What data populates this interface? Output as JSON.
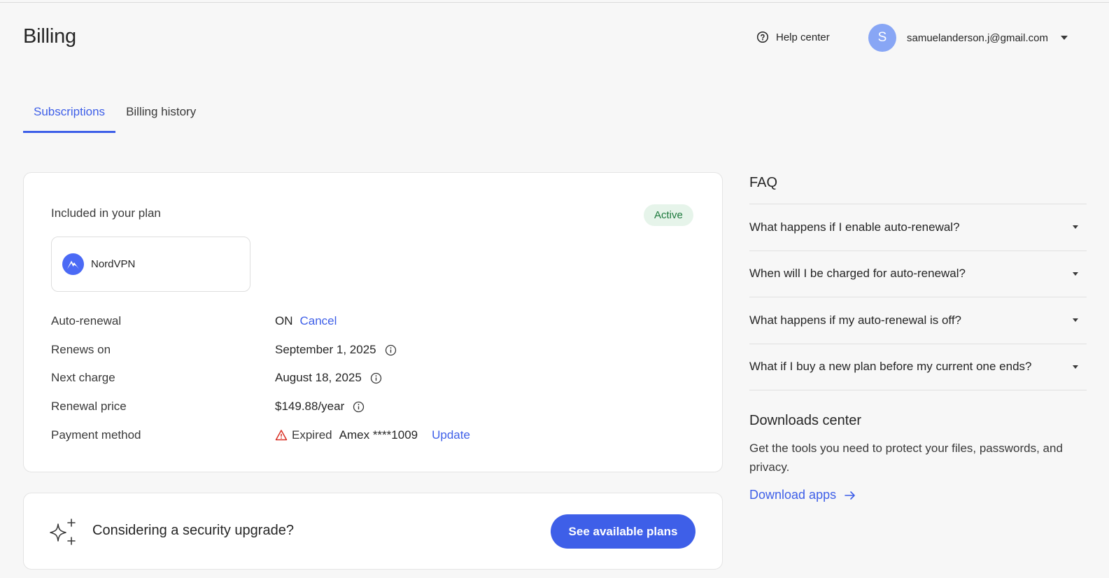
{
  "header": {
    "title": "Billing",
    "help_label": "Help center",
    "avatar_initial": "S",
    "email": "samuelanderson.j@gmail.com"
  },
  "tabs": [
    {
      "label": "Subscriptions",
      "active": true
    },
    {
      "label": "Billing history",
      "active": false
    }
  ],
  "plan": {
    "included_label": "Included in your plan",
    "status": "Active",
    "product_name": "NordVPN",
    "rows": {
      "auto_renewal": {
        "label": "Auto-renewal",
        "value": "ON",
        "action": "Cancel"
      },
      "renews_on": {
        "label": "Renews on",
        "value": "September 1, 2025"
      },
      "next_charge": {
        "label": "Next charge",
        "value": "August 18, 2025"
      },
      "renewal_price": {
        "label": "Renewal price",
        "value": "$149.88/year"
      },
      "payment_method": {
        "label": "Payment method",
        "status": "Expired",
        "card": "Amex ****1009",
        "action": "Update"
      }
    }
  },
  "upgrade": {
    "text": "Considering a security upgrade?",
    "button": "See available plans"
  },
  "faq": {
    "title": "FAQ",
    "items": [
      "What happens if I enable auto-renewal?",
      "When will I be charged for auto-renewal?",
      "What happens if my auto-renewal is off?",
      "What if I buy a new plan before my current one ends?"
    ]
  },
  "downloads": {
    "title": "Downloads center",
    "text": "Get the tools you need to protect your files, passwords, and privacy.",
    "link": "Download apps"
  },
  "colors": {
    "accent": "#3e5fe8",
    "active_badge_bg": "#e6f4ea",
    "active_badge_text": "#1e7a3e",
    "warning": "#d93025"
  }
}
